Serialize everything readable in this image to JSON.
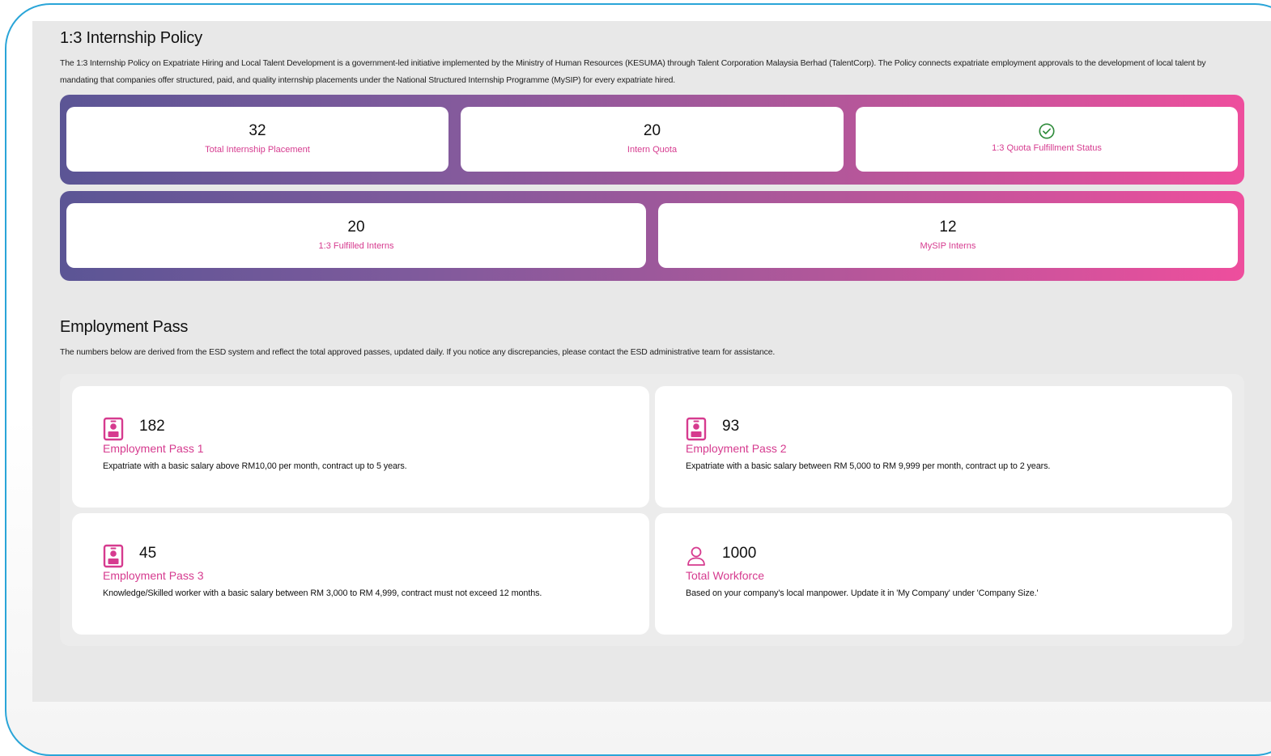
{
  "internship": {
    "title": "1:3 Internship Policy",
    "description": "The 1:3 Internship Policy on Expatriate Hiring and Local Talent Development is a government-led initiative implemented by the Ministry of Human Resources (KESUMA) through Talent Corporation Malaysia Berhad (TalentCorp). The Policy connects expatriate employment approvals to the development of local talent by mandating that companies offer structured, paid, and quality internship placements under the National Structured Internship Programme (MySIP) for every expatriate hired.",
    "stats_row1": [
      {
        "value": "32",
        "label": "Total Internship Placement"
      },
      {
        "value": "20",
        "label": "Intern Quota"
      },
      {
        "icon": "check-circle-icon",
        "label": "1:3 Quota Fulfillment Status"
      }
    ],
    "stats_row2": [
      {
        "value": "20",
        "label": "1:3 Fulfilled Interns"
      },
      {
        "value": "12",
        "label": "MySIP Interns"
      }
    ]
  },
  "employment": {
    "title": "Employment Pass",
    "description": "The numbers below are derived from the ESD system and reflect the total approved passes, updated daily. If you notice any discrepancies, please contact the ESD administrative team for assistance.",
    "cards": [
      {
        "icon": "id-badge-icon",
        "value": "182",
        "label": "Employment Pass 1",
        "description": "Expatriate with a basic salary above RM10,00 per month, contract up to 5 years."
      },
      {
        "icon": "id-badge-icon",
        "value": "93",
        "label": "Employment Pass 2",
        "description": "Expatriate with a basic salary between RM 5,000 to RM 9,999 per month, contract up to 2 years."
      },
      {
        "icon": "id-badge-icon",
        "value": "45",
        "label": "Employment Pass 3",
        "description": "Knowledge/Skilled worker with a basic salary between RM 3,000 to RM 4,999, contract must not exceed 12 months."
      },
      {
        "icon": "user-icon",
        "value": "1000",
        "label": "Total Workforce",
        "description": "Based on your company's local manpower. Update it in 'My Company' under 'Company Size.'"
      }
    ]
  },
  "colors": {
    "accent_pink": "#d63b8f",
    "gradient_start": "#5b5595",
    "gradient_end": "#ee4e9d",
    "check_green": "#2e8b3a",
    "frame_border": "#2aa5d8"
  }
}
